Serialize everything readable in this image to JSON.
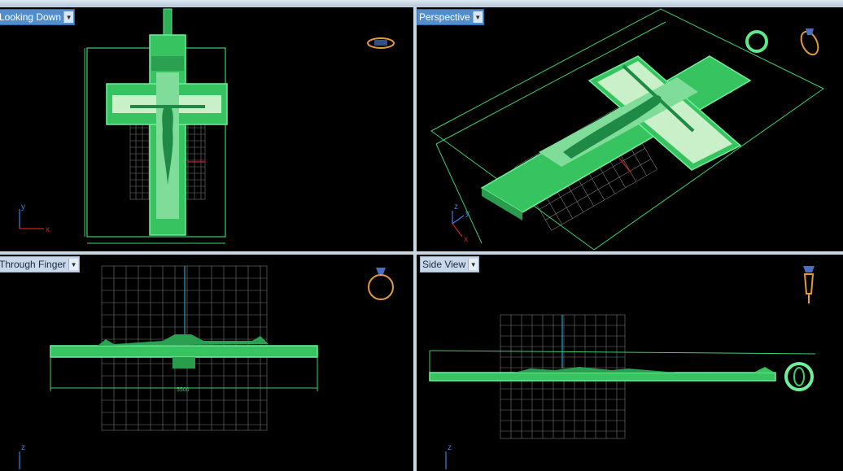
{
  "viewports": {
    "top_left": {
      "label": "Looking Down",
      "dropdown_glyph": "▼"
    },
    "top_right": {
      "label": "Perspective",
      "dropdown_glyph": "▼"
    },
    "bottom_left": {
      "label": "Through Finger",
      "dropdown_glyph": "▼"
    },
    "bottom_right": {
      "label": "Side View",
      "dropdown_glyph": "▼"
    }
  },
  "axes": {
    "x": "x",
    "y": "y",
    "z": "z"
  },
  "dimensions": {
    "width_readout": "5500"
  },
  "icons": {
    "view_gizmo": "ring-orientation-icon",
    "dropdown": "chevron-down-icon"
  },
  "colors": {
    "background": "#000000",
    "model": "#3ecf6a",
    "grid": "#777777",
    "axis_x": "#d02020",
    "axis_y": "#3a7fe0",
    "gizmo": "#e39a3a"
  }
}
